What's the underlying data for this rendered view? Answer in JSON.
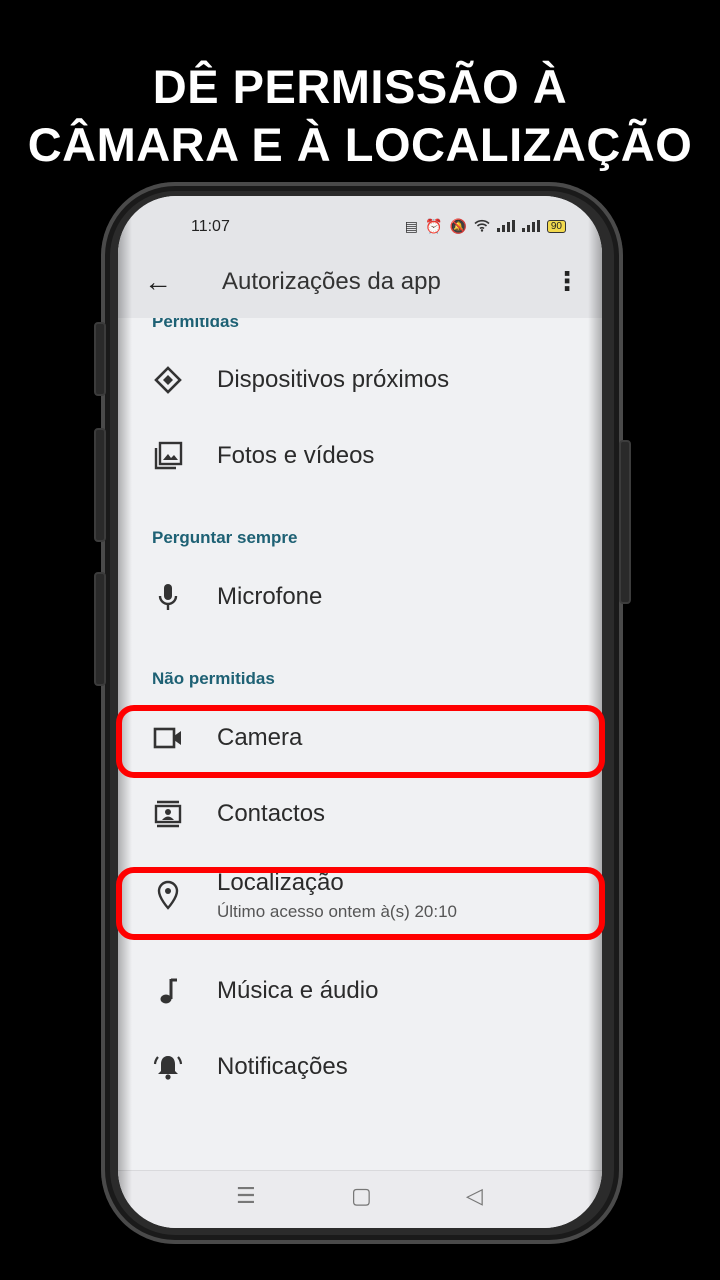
{
  "headline": {
    "line1": "DÊ PERMISSÃO À",
    "line2": "CÂMARA E À LOCALIZAÇÃO"
  },
  "status_bar": {
    "time": "11:07",
    "battery": "90"
  },
  "app_bar": {
    "title": "Autorizações da app"
  },
  "sections": {
    "allowed": "Permitidas",
    "ask_every_time": "Perguntar sempre",
    "not_allowed": "Não permitidas"
  },
  "items": {
    "nearby_devices": "Dispositivos próximos",
    "photos_videos": "Fotos e vídeos",
    "microphone": "Microfone",
    "camera": "Camera",
    "contacts": "Contactos",
    "location": "Localização",
    "location_sub": "Último acesso ontem à(s) 20:10",
    "music_audio": "Música e áudio",
    "notifications": "Notificações"
  },
  "colors": {
    "highlight": "#ff0000",
    "section_header": "#1e6174"
  }
}
